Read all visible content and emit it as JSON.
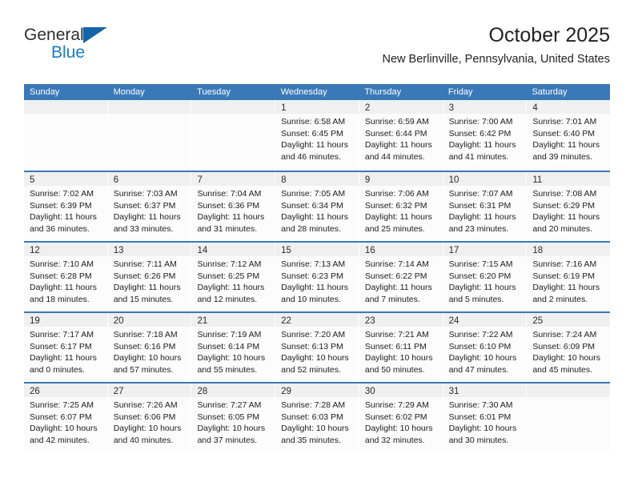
{
  "brand": {
    "word_one": "General",
    "word_two": "Blue",
    "flag_icon": "triangle-flag-icon",
    "accent_color": "#1a7bc4"
  },
  "header": {
    "title": "October 2025",
    "subtitle": "New Berlinville, Pennsylvania, United States"
  },
  "calendar": {
    "header_bg": "#3a79b8",
    "row_divider_color": "#3a79b8",
    "day_band_bg": "#f0f0f0",
    "weekdays": [
      "Sunday",
      "Monday",
      "Tuesday",
      "Wednesday",
      "Thursday",
      "Friday",
      "Saturday"
    ],
    "weeks": [
      [
        {
          "day": "",
          "lines": []
        },
        {
          "day": "",
          "lines": []
        },
        {
          "day": "",
          "lines": []
        },
        {
          "day": "1",
          "lines": [
            "Sunrise: 6:58 AM",
            "Sunset: 6:45 PM",
            "Daylight: 11 hours",
            "and 46 minutes."
          ]
        },
        {
          "day": "2",
          "lines": [
            "Sunrise: 6:59 AM",
            "Sunset: 6:44 PM",
            "Daylight: 11 hours",
            "and 44 minutes."
          ]
        },
        {
          "day": "3",
          "lines": [
            "Sunrise: 7:00 AM",
            "Sunset: 6:42 PM",
            "Daylight: 11 hours",
            "and 41 minutes."
          ]
        },
        {
          "day": "4",
          "lines": [
            "Sunrise: 7:01 AM",
            "Sunset: 6:40 PM",
            "Daylight: 11 hours",
            "and 39 minutes."
          ]
        }
      ],
      [
        {
          "day": "5",
          "lines": [
            "Sunrise: 7:02 AM",
            "Sunset: 6:39 PM",
            "Daylight: 11 hours",
            "and 36 minutes."
          ]
        },
        {
          "day": "6",
          "lines": [
            "Sunrise: 7:03 AM",
            "Sunset: 6:37 PM",
            "Daylight: 11 hours",
            "and 33 minutes."
          ]
        },
        {
          "day": "7",
          "lines": [
            "Sunrise: 7:04 AM",
            "Sunset: 6:36 PM",
            "Daylight: 11 hours",
            "and 31 minutes."
          ]
        },
        {
          "day": "8",
          "lines": [
            "Sunrise: 7:05 AM",
            "Sunset: 6:34 PM",
            "Daylight: 11 hours",
            "and 28 minutes."
          ]
        },
        {
          "day": "9",
          "lines": [
            "Sunrise: 7:06 AM",
            "Sunset: 6:32 PM",
            "Daylight: 11 hours",
            "and 25 minutes."
          ]
        },
        {
          "day": "10",
          "lines": [
            "Sunrise: 7:07 AM",
            "Sunset: 6:31 PM",
            "Daylight: 11 hours",
            "and 23 minutes."
          ]
        },
        {
          "day": "11",
          "lines": [
            "Sunrise: 7:08 AM",
            "Sunset: 6:29 PM",
            "Daylight: 11 hours",
            "and 20 minutes."
          ]
        }
      ],
      [
        {
          "day": "12",
          "lines": [
            "Sunrise: 7:10 AM",
            "Sunset: 6:28 PM",
            "Daylight: 11 hours",
            "and 18 minutes."
          ]
        },
        {
          "day": "13",
          "lines": [
            "Sunrise: 7:11 AM",
            "Sunset: 6:26 PM",
            "Daylight: 11 hours",
            "and 15 minutes."
          ]
        },
        {
          "day": "14",
          "lines": [
            "Sunrise: 7:12 AM",
            "Sunset: 6:25 PM",
            "Daylight: 11 hours",
            "and 12 minutes."
          ]
        },
        {
          "day": "15",
          "lines": [
            "Sunrise: 7:13 AM",
            "Sunset: 6:23 PM",
            "Daylight: 11 hours",
            "and 10 minutes."
          ]
        },
        {
          "day": "16",
          "lines": [
            "Sunrise: 7:14 AM",
            "Sunset: 6:22 PM",
            "Daylight: 11 hours",
            "and 7 minutes."
          ]
        },
        {
          "day": "17",
          "lines": [
            "Sunrise: 7:15 AM",
            "Sunset: 6:20 PM",
            "Daylight: 11 hours",
            "and 5 minutes."
          ]
        },
        {
          "day": "18",
          "lines": [
            "Sunrise: 7:16 AM",
            "Sunset: 6:19 PM",
            "Daylight: 11 hours",
            "and 2 minutes."
          ]
        }
      ],
      [
        {
          "day": "19",
          "lines": [
            "Sunrise: 7:17 AM",
            "Sunset: 6:17 PM",
            "Daylight: 11 hours",
            "and 0 minutes."
          ]
        },
        {
          "day": "20",
          "lines": [
            "Sunrise: 7:18 AM",
            "Sunset: 6:16 PM",
            "Daylight: 10 hours",
            "and 57 minutes."
          ]
        },
        {
          "day": "21",
          "lines": [
            "Sunrise: 7:19 AM",
            "Sunset: 6:14 PM",
            "Daylight: 10 hours",
            "and 55 minutes."
          ]
        },
        {
          "day": "22",
          "lines": [
            "Sunrise: 7:20 AM",
            "Sunset: 6:13 PM",
            "Daylight: 10 hours",
            "and 52 minutes."
          ]
        },
        {
          "day": "23",
          "lines": [
            "Sunrise: 7:21 AM",
            "Sunset: 6:11 PM",
            "Daylight: 10 hours",
            "and 50 minutes."
          ]
        },
        {
          "day": "24",
          "lines": [
            "Sunrise: 7:22 AM",
            "Sunset: 6:10 PM",
            "Daylight: 10 hours",
            "and 47 minutes."
          ]
        },
        {
          "day": "25",
          "lines": [
            "Sunrise: 7:24 AM",
            "Sunset: 6:09 PM",
            "Daylight: 10 hours",
            "and 45 minutes."
          ]
        }
      ],
      [
        {
          "day": "26",
          "lines": [
            "Sunrise: 7:25 AM",
            "Sunset: 6:07 PM",
            "Daylight: 10 hours",
            "and 42 minutes."
          ]
        },
        {
          "day": "27",
          "lines": [
            "Sunrise: 7:26 AM",
            "Sunset: 6:06 PM",
            "Daylight: 10 hours",
            "and 40 minutes."
          ]
        },
        {
          "day": "28",
          "lines": [
            "Sunrise: 7:27 AM",
            "Sunset: 6:05 PM",
            "Daylight: 10 hours",
            "and 37 minutes."
          ]
        },
        {
          "day": "29",
          "lines": [
            "Sunrise: 7:28 AM",
            "Sunset: 6:03 PM",
            "Daylight: 10 hours",
            "and 35 minutes."
          ]
        },
        {
          "day": "30",
          "lines": [
            "Sunrise: 7:29 AM",
            "Sunset: 6:02 PM",
            "Daylight: 10 hours",
            "and 32 minutes."
          ]
        },
        {
          "day": "31",
          "lines": [
            "Sunrise: 7:30 AM",
            "Sunset: 6:01 PM",
            "Daylight: 10 hours",
            "and 30 minutes."
          ]
        },
        {
          "day": "",
          "lines": []
        }
      ]
    ]
  }
}
